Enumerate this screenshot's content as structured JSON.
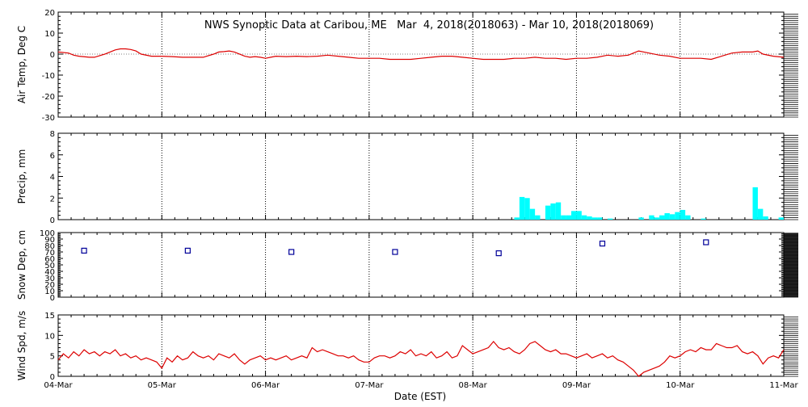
{
  "title": "NWS Synoptic Data at Caribou, ME   Mar  4, 2018(2018063) - Mar 10, 2018(2018069)",
  "x_axis": {
    "label": "Date (EST)",
    "ticks": [
      "04-Mar",
      "05-Mar",
      "06-Mar",
      "07-Mar",
      "08-Mar",
      "09-Mar",
      "10-Mar",
      "11-Mar"
    ]
  },
  "colors": {
    "temp": "#dd0000",
    "precip": "#00ffff",
    "snow": "#000099",
    "wind": "#dd0000",
    "grid": "#000000"
  },
  "chart_data": [
    {
      "type": "line",
      "name": "air-temp",
      "ylabel": "Air Temp, Deg C",
      "ylim": [
        -30,
        20
      ],
      "yticks": [
        -30,
        -20,
        -10,
        0,
        10,
        20
      ],
      "x": [
        0,
        0.1,
        0.15,
        0.2,
        0.3,
        0.35,
        0.45,
        0.55,
        0.6,
        0.65,
        0.7,
        0.75,
        0.8,
        0.9,
        1.0,
        1.1,
        1.2,
        1.3,
        1.4,
        1.5,
        1.55,
        1.6,
        1.65,
        1.7,
        1.8,
        1.85,
        1.9,
        1.95,
        2.0,
        2.05,
        2.1,
        2.2,
        2.3,
        2.4,
        2.5,
        2.6,
        2.7,
        2.8,
        2.9,
        3.0,
        3.1,
        3.2,
        3.3,
        3.4,
        3.5,
        3.6,
        3.7,
        3.8,
        3.9,
        4.0,
        4.1,
        4.2,
        4.3,
        4.4,
        4.5,
        4.6,
        4.7,
        4.8,
        4.9,
        5.0,
        5.1,
        5.2,
        5.3,
        5.4,
        5.5,
        5.55,
        5.6,
        5.7,
        5.8,
        5.9,
        6.0,
        6.1,
        6.2,
        6.3,
        6.4,
        6.5,
        6.6,
        6.7,
        6.75,
        6.8,
        6.9,
        7.0
      ],
      "y": [
        1,
        0.5,
        -0.5,
        -1,
        -1.5,
        -1.5,
        0,
        2,
        2.5,
        2.5,
        2.2,
        1.5,
        0,
        -1,
        -1,
        -1.2,
        -1.5,
        -1.5,
        -1.5,
        0,
        1,
        1.2,
        1.5,
        1,
        -1,
        -1.5,
        -1.2,
        -1.5,
        -2,
        -1.5,
        -1,
        -1.2,
        -1,
        -1.2,
        -1,
        -0.5,
        -1,
        -1.5,
        -2,
        -2,
        -2,
        -2.5,
        -2.5,
        -2.5,
        -2,
        -1.5,
        -1,
        -1,
        -1.5,
        -2,
        -2.5,
        -2.5,
        -2.5,
        -2,
        -2,
        -1.5,
        -2,
        -2,
        -2.5,
        -2,
        -2,
        -1.5,
        -0.5,
        -1,
        -0.5,
        0.5,
        1.5,
        0.5,
        -0.5,
        -1,
        -2,
        -2,
        -2,
        -2.5,
        -1,
        0.5,
        1,
        1,
        1.5,
        0,
        -1,
        -1.5
      ],
      "color": "#dd0000"
    },
    {
      "type": "bar",
      "name": "precip",
      "ylabel": "Precip, mm",
      "ylim": [
        0,
        8
      ],
      "yticks": [
        0,
        2,
        4,
        6,
        8
      ],
      "x": [
        4.4,
        4.45,
        4.5,
        4.55,
        4.6,
        4.7,
        4.75,
        4.8,
        4.85,
        4.9,
        4.95,
        5.0,
        5.05,
        5.1,
        5.15,
        5.2,
        5.3,
        5.6,
        5.7,
        5.75,
        5.8,
        5.85,
        5.9,
        5.95,
        6.0,
        6.05,
        6.2,
        6.7,
        6.75,
        6.8,
        6.95
      ],
      "values": [
        0.2,
        2.1,
        2.0,
        1.0,
        0.4,
        1.3,
        1.5,
        1.6,
        0.4,
        0.4,
        0.8,
        0.8,
        0.4,
        0.3,
        0.2,
        0.2,
        0.1,
        0.2,
        0.4,
        0.2,
        0.4,
        0.6,
        0.5,
        0.7,
        0.9,
        0.4,
        0.1,
        3.0,
        1.0,
        0.3,
        0.2
      ],
      "color": "#00ffff"
    },
    {
      "type": "scatter",
      "name": "snow-depth",
      "ylabel": "Snow Dep, cm",
      "ylim": [
        0,
        100
      ],
      "yticks": [
        0,
        10,
        20,
        30,
        40,
        50,
        60,
        70,
        80,
        90,
        100
      ],
      "x": [
        0.25,
        1.25,
        2.25,
        3.25,
        4.25,
        5.25,
        6.25
      ],
      "y": [
        72,
        72,
        70,
        70,
        68,
        83,
        85
      ],
      "color": "#000099"
    },
    {
      "type": "line",
      "name": "wind-speed",
      "ylabel": "Wind Spd, m/s",
      "ylim": [
        0,
        15
      ],
      "yticks": [
        0,
        5,
        10,
        15
      ],
      "x": [
        0,
        0.05,
        0.1,
        0.15,
        0.2,
        0.25,
        0.3,
        0.35,
        0.4,
        0.45,
        0.5,
        0.55,
        0.6,
        0.65,
        0.7,
        0.75,
        0.8,
        0.85,
        0.9,
        0.95,
        1.0,
        1.05,
        1.1,
        1.15,
        1.2,
        1.25,
        1.3,
        1.35,
        1.4,
        1.45,
        1.5,
        1.55,
        1.6,
        1.65,
        1.7,
        1.75,
        1.8,
        1.85,
        1.9,
        1.95,
        2.0,
        2.05,
        2.1,
        2.15,
        2.2,
        2.25,
        2.3,
        2.35,
        2.4,
        2.45,
        2.5,
        2.55,
        2.6,
        2.65,
        2.7,
        2.75,
        2.8,
        2.85,
        2.9,
        2.95,
        3.0,
        3.05,
        3.1,
        3.15,
        3.2,
        3.25,
        3.3,
        3.35,
        3.4,
        3.45,
        3.5,
        3.55,
        3.6,
        3.65,
        3.7,
        3.75,
        3.8,
        3.85,
        3.9,
        3.95,
        4.0,
        4.05,
        4.1,
        4.15,
        4.2,
        4.25,
        4.3,
        4.35,
        4.4,
        4.45,
        4.5,
        4.55,
        4.6,
        4.65,
        4.7,
        4.75,
        4.8,
        4.85,
        4.9,
        4.95,
        5.0,
        5.05,
        5.1,
        5.15,
        5.2,
        5.25,
        5.3,
        5.35,
        5.4,
        5.45,
        5.5,
        5.55,
        5.6,
        5.65,
        5.7,
        5.75,
        5.8,
        5.85,
        5.9,
        5.95,
        6.0,
        6.05,
        6.1,
        6.15,
        6.2,
        6.25,
        6.3,
        6.35,
        6.4,
        6.45,
        6.5,
        6.55,
        6.6,
        6.65,
        6.7,
        6.75,
        6.8,
        6.85,
        6.9,
        6.95,
        7.0
      ],
      "y": [
        4,
        5.5,
        4.5,
        6,
        5,
        6.5,
        5.5,
        6,
        5,
        6,
        5.5,
        6.5,
        5,
        5.5,
        4.5,
        5,
        4,
        4.5,
        4,
        3.5,
        2,
        4.5,
        3.5,
        5,
        4,
        4.5,
        6,
        5,
        4.5,
        5,
        4,
        5.5,
        5,
        4.5,
        5.5,
        4,
        3,
        4,
        4.5,
        5,
        4,
        4.5,
        4,
        4.5,
        5,
        4,
        4.5,
        5,
        4.5,
        7,
        6,
        6.5,
        6,
        5.5,
        5,
        5,
        4.5,
        5,
        4,
        3.5,
        3.5,
        4.5,
        5,
        5,
        4.5,
        5,
        6,
        5.5,
        6.5,
        5,
        5.5,
        5,
        6,
        4.5,
        5,
        6,
        4.5,
        5,
        7.5,
        6.5,
        5.5,
        6,
        6.5,
        7,
        8.5,
        7,
        6.5,
        7,
        6,
        5.5,
        6.5,
        8,
        8.5,
        7.5,
        6.5,
        6,
        6.5,
        5.5,
        5.5,
        5,
        4.5,
        5,
        5.5,
        4.5,
        5,
        5.5,
        4.5,
        5,
        4,
        3.5,
        2.5,
        1.5,
        0,
        1,
        1.5,
        2,
        2.5,
        3.5,
        5,
        4.5,
        5,
        6,
        6.5,
        6,
        7,
        6.5,
        6.5,
        8,
        7.5,
        7,
        7,
        7.5,
        6,
        5.5,
        6,
        5,
        3,
        4.5,
        5,
        4.5,
        6.5,
        5
      ],
      "color": "#dd0000"
    }
  ]
}
